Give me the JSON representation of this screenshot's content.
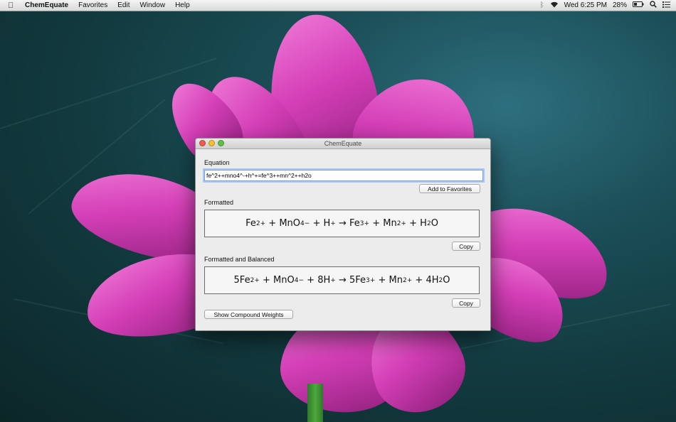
{
  "menubar": {
    "app_name": "ChemEquate",
    "menus": [
      "Favorites",
      "Edit",
      "Window",
      "Help"
    ],
    "clock": "Wed 6:25 PM",
    "battery": "28%"
  },
  "window": {
    "title": "ChemEquate",
    "equation_label": "Equation",
    "equation_value": "fe^2++mno4^-+h^+=fe^3++mn^2++h2o",
    "add_favorites_label": "Add to Favorites",
    "formatted_label": "Formatted",
    "formatted_equation": {
      "terms": [
        "Fe",
        "2+",
        "MnO",
        "4",
        "−",
        "H",
        "+",
        "Fe",
        "3+",
        "Mn",
        "2+",
        "H",
        "2",
        "O"
      ],
      "plus": "+",
      "arrow": "→"
    },
    "copy_label_1": "Copy",
    "balanced_label": "Formatted and Balanced",
    "balanced_equation": {
      "coef_fe": "5Fe",
      "fe_charge": "2+",
      "mno": "MnO",
      "mno_sub": "4",
      "mno_charge": "−",
      "coef_h": "8H",
      "h_charge": "+",
      "coef_fe3": "5Fe",
      "fe3_charge": "3+",
      "mn": "Mn",
      "mn_charge": "2+",
      "coef_h2o": "4H",
      "h2o_sub": "2",
      "h2o_o": "O"
    },
    "copy_label_2": "Copy",
    "compound_weights_label": "Show Compound Weights"
  }
}
